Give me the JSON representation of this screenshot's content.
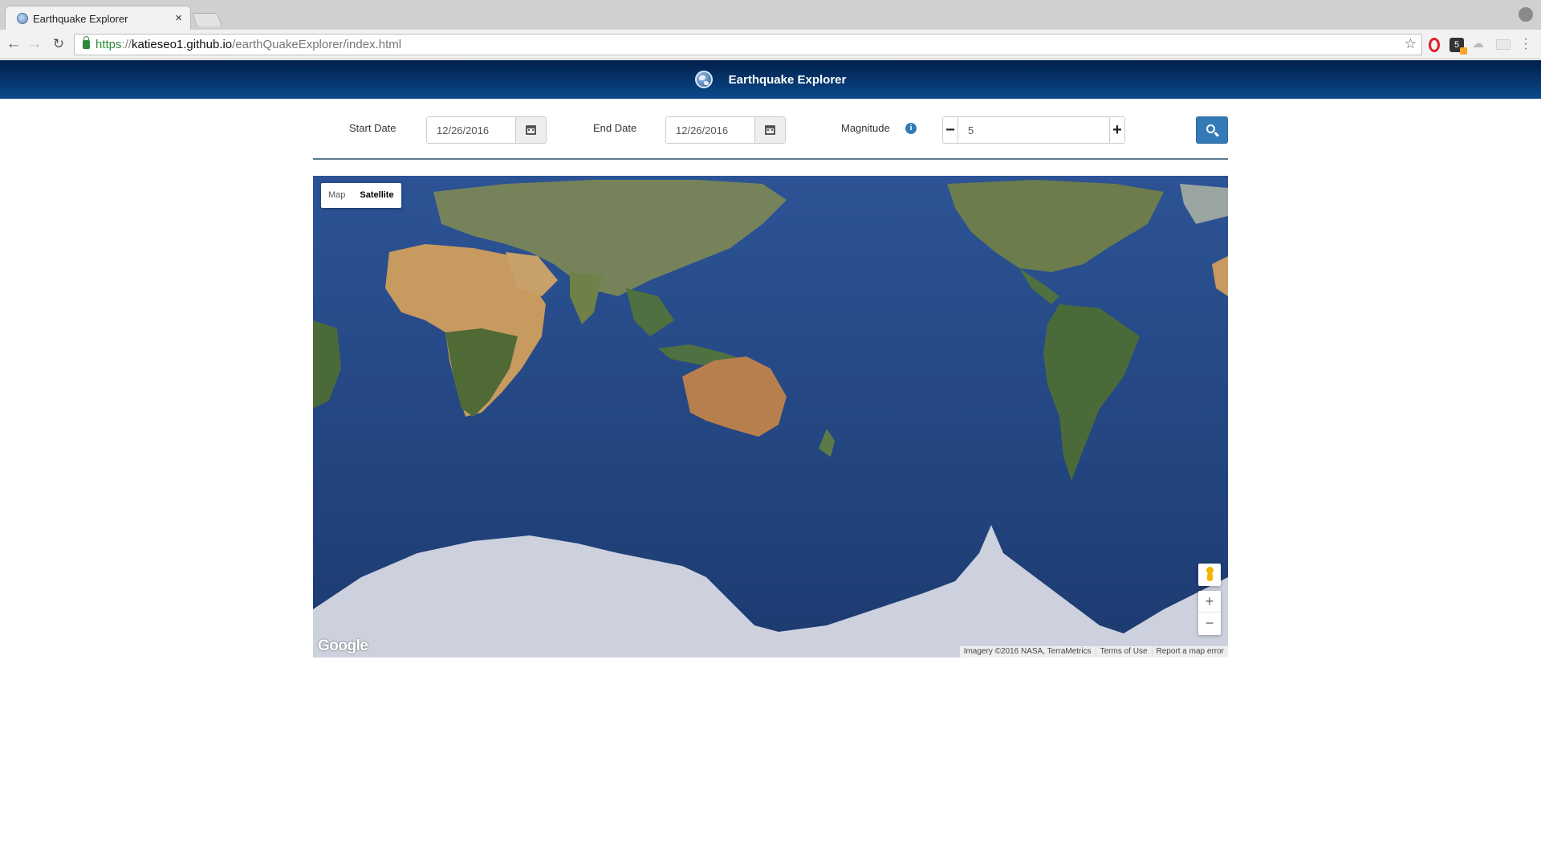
{
  "browser": {
    "tab_title": "Earthquake Explorer",
    "url_scheme": "https",
    "url_sep": "://",
    "url_host": "katieseo1.github.io",
    "url_path": "/earthQuakeExplorer/index.html",
    "badge_text": "5"
  },
  "app": {
    "title": "Earthquake Explorer"
  },
  "controls": {
    "start_label": "Start Date",
    "start_value": "12/26/2016",
    "end_label": "End Date",
    "end_value": "12/26/2016",
    "magnitude_label": "Magnitude",
    "info_glyph": "i",
    "magnitude_value": "5",
    "minus_glyph": "−",
    "plus_glyph": "+"
  },
  "map": {
    "type_map": "Map",
    "type_satellite": "Satellite",
    "selected_type": "Satellite",
    "zoom_in": "+",
    "zoom_out": "−",
    "logo": "Google",
    "imagery": "Imagery ©2016 NASA, TerraMetrics",
    "terms": "Terms of Use",
    "report": "Report a map error"
  },
  "colors": {
    "header_dark": "#001f4a",
    "header_light": "#0b4a8c",
    "primary": "#337ab7",
    "ocean": "#264a87",
    "antarctica": "#cdd1dd"
  }
}
